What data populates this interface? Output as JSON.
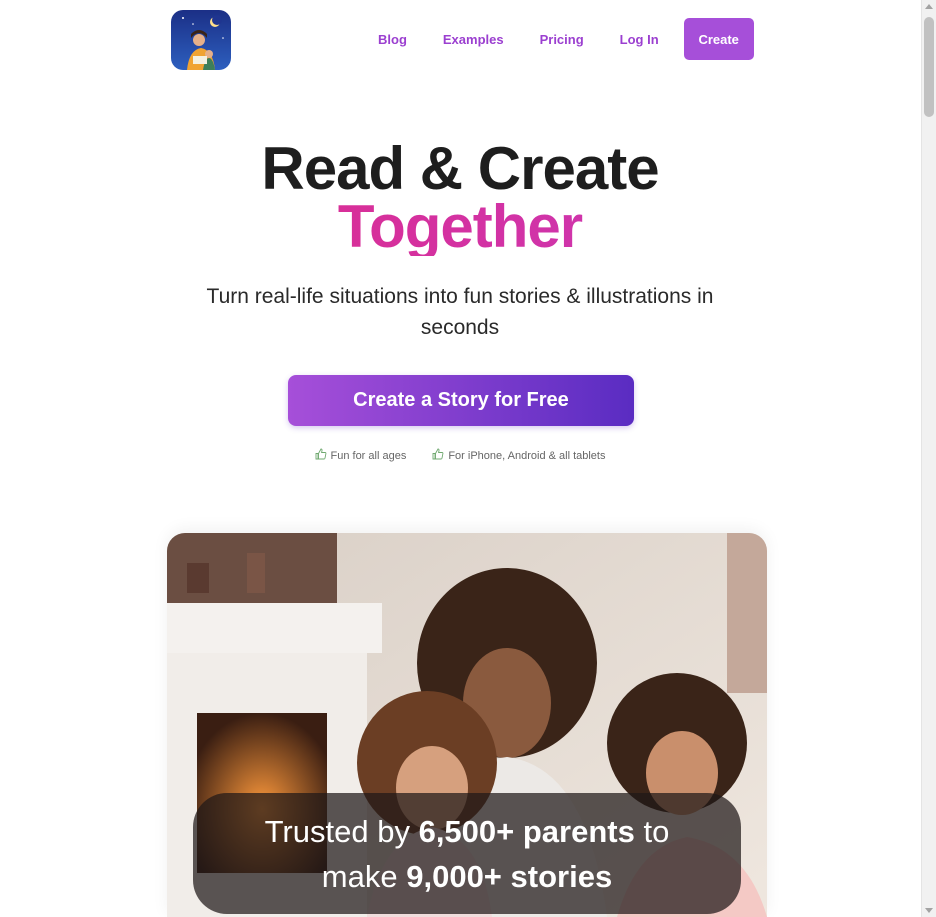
{
  "nav": {
    "blog": "Blog",
    "examples": "Examples",
    "pricing": "Pricing",
    "login": "Log In",
    "create": "Create"
  },
  "hero": {
    "title_line1": "Read & Create",
    "title_line2": "Together",
    "subtitle": "Turn real-life situations into fun stories & illustrations in seconds",
    "cta": "Create a Story for Free",
    "features": [
      "Fun for all ages",
      "For iPhone, Android & all tablets"
    ]
  },
  "trust": {
    "prefix": "Trusted by",
    "parents": "6,500+ parents",
    "to": "to",
    "make": "make",
    "stories": "9,000+ stories"
  },
  "colors": {
    "brand_purple": "#a64fd9",
    "gradient_end": "#5a2cc2",
    "accent_pink": "#e3287f"
  },
  "icons": [
    "app-logo-icon",
    "thumbs-up-icon"
  ]
}
